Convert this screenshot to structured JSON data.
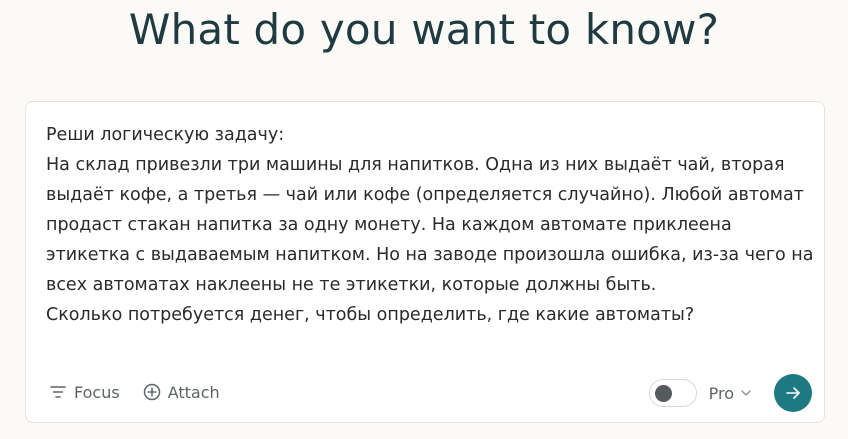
{
  "heading": "What do you want to know?",
  "query": {
    "text": "Реши логическую задачу:\nНа склад привезли три машины для напитков. Одна из них выдаёт чай, вторая выдаёт кофе, а третья — чай или кофе (определяется случайно). Любой автомат продаст стакан напитка за одну монету. На каждом автомате приклеена этикетка с выдаваемым напитком. Но на заводе произошла ошибка, из-за чего на всех автоматах наклеены не те этикетки, которые должны быть.\nСколько потребуется денег, чтобы определить, где какие автоматы?"
  },
  "toolbar": {
    "focus_label": "Focus",
    "attach_label": "Attach",
    "focus_icon": "filter-lines-icon",
    "attach_icon": "plus-circle-icon"
  },
  "controls": {
    "pro_label": "Pro",
    "pro_toggle_on": false,
    "submit_icon": "arrow-right-icon"
  },
  "colors": {
    "background": "#fbfaf6",
    "heading": "#1f3a40",
    "accent": "#1e7a82",
    "muted": "#5e6466"
  }
}
